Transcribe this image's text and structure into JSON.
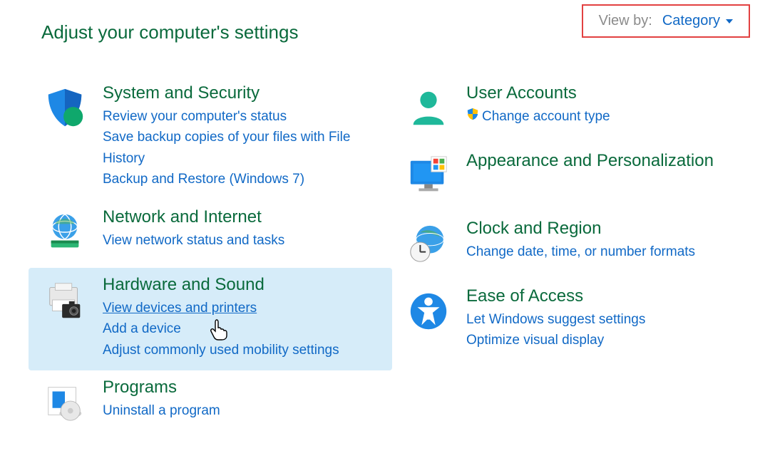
{
  "header": {
    "title": "Adjust your computer's settings",
    "viewby_label": "View by:",
    "viewby_value": "Category"
  },
  "left": [
    {
      "title": "System and Security",
      "links": [
        "Review your computer's status",
        "Save backup copies of your files with File History",
        "Backup and Restore (Windows 7)"
      ]
    },
    {
      "title": "Network and Internet",
      "links": [
        "View network status and tasks"
      ]
    },
    {
      "title": "Hardware and Sound",
      "links": [
        "View devices and printers",
        "Add a device",
        "Adjust commonly used mobility settings"
      ]
    },
    {
      "title": "Programs",
      "links": [
        "Uninstall a program"
      ]
    }
  ],
  "right": [
    {
      "title": "User Accounts",
      "links": [
        "Change account type"
      ]
    },
    {
      "title": "Appearance and Personalization",
      "links": []
    },
    {
      "title": "Clock and Region",
      "text": [
        "Change date, time, or number formats"
      ]
    },
    {
      "title": "Ease of Access",
      "text": [
        "Let Windows suggest settings",
        "Optimize visual display"
      ]
    }
  ]
}
